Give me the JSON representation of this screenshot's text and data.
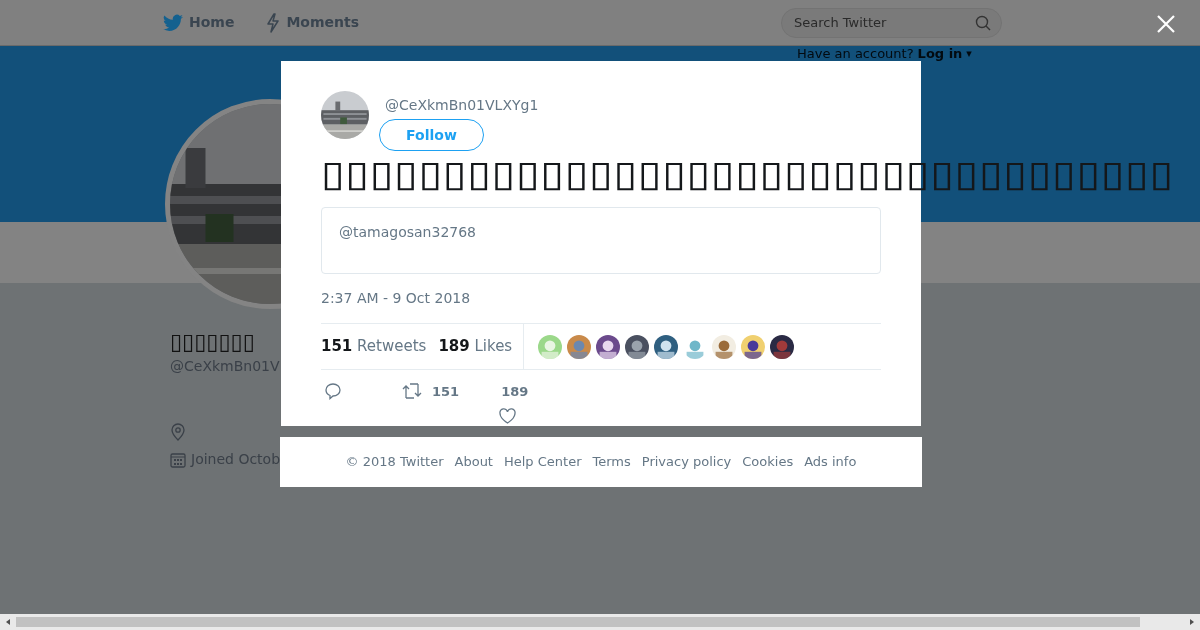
{
  "nav": {
    "items": [
      {
        "label": "Home",
        "kind": "bird"
      },
      {
        "label": "Moments",
        "kind": "bolt"
      }
    ],
    "search": {
      "placeholder": "Search Twitter"
    }
  },
  "login": {
    "prompt": "Have an account?",
    "link": "Log in",
    "caret": "▾"
  },
  "profile": {
    "name": "▯▯▯▯▯▯▯",
    "handle": "@CeXkmBn01V",
    "joined": "Joined Octob"
  },
  "tweet": {
    "handle": "@CeXkmBn01VLXYg1",
    "follow": "Follow",
    "text": "▯▯▯▯▯▯▯▯▯▯▯▯▯▯▯▯▯▯▯▯▯▯▯▯▯▯▯▯▯▯▯▯▯▯▯",
    "quote": "@tamagosan32768",
    "time": "2:37 AM - 9 Oct 2018",
    "retweets": {
      "count": "151",
      "label": "Retweets"
    },
    "likes": {
      "count": "189",
      "label": "Likes"
    },
    "actions": {
      "retweet_count": "151",
      "like_count": "189"
    }
  },
  "footer": {
    "links": [
      "© 2018 Twitter",
      "About",
      "Help Center",
      "Terms",
      "Privacy policy",
      "Cookies",
      "Ads info"
    ]
  }
}
